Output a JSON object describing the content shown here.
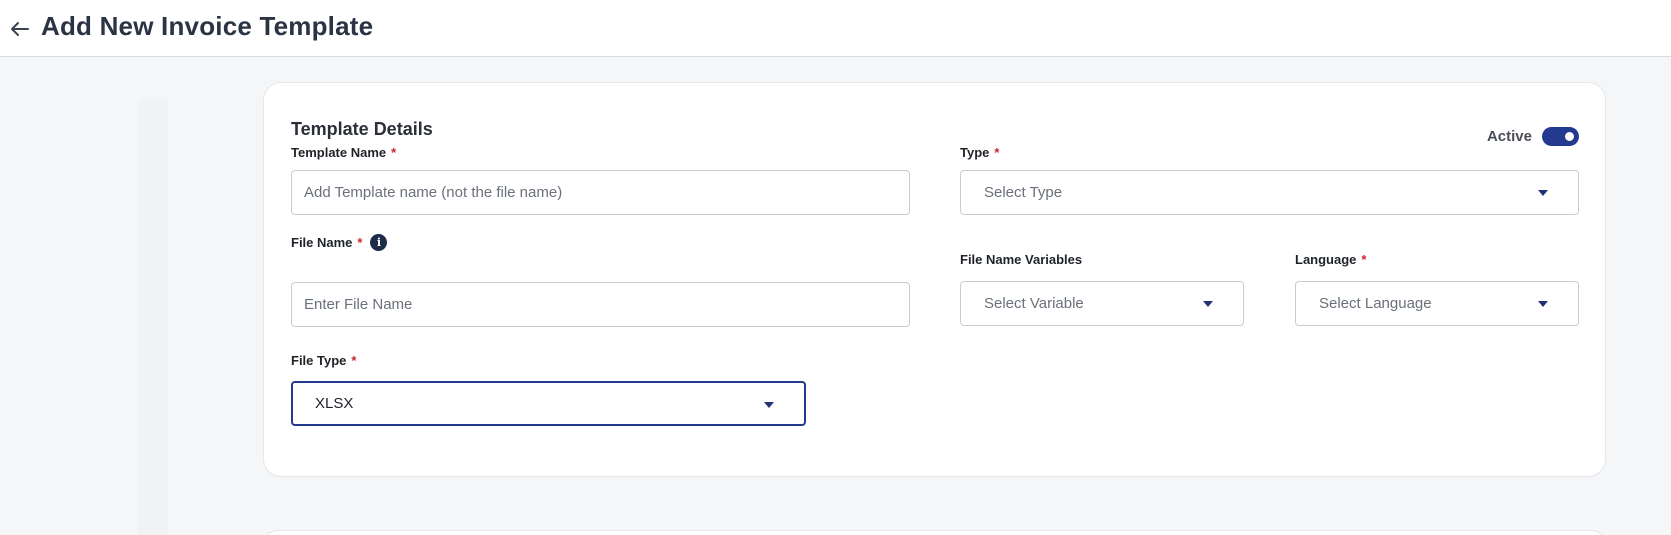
{
  "header": {
    "title": "Add New Invoice Template",
    "back_icon": "arrow-left-icon"
  },
  "form": {
    "section_title": "Template Details",
    "active": {
      "label": "Active",
      "on": true
    },
    "template_name": {
      "label": "Template Name",
      "placeholder": "Add Template name (not the file name)",
      "value": ""
    },
    "type": {
      "label": "Type",
      "placeholder": "Select Type"
    },
    "file_name": {
      "label": "File Name",
      "placeholder": "Enter File Name",
      "value": "",
      "info_icon": "info-icon"
    },
    "file_name_variables": {
      "label": "File Name Variables",
      "placeholder": "Select Variable"
    },
    "language": {
      "label": "Language",
      "placeholder": "Select Language"
    },
    "file_type": {
      "label": "File Type",
      "value": "XLSX"
    },
    "required_mark": "*"
  },
  "colors": {
    "accent": "#243a8f",
    "required": "#c62828",
    "title": "#2a3444"
  }
}
